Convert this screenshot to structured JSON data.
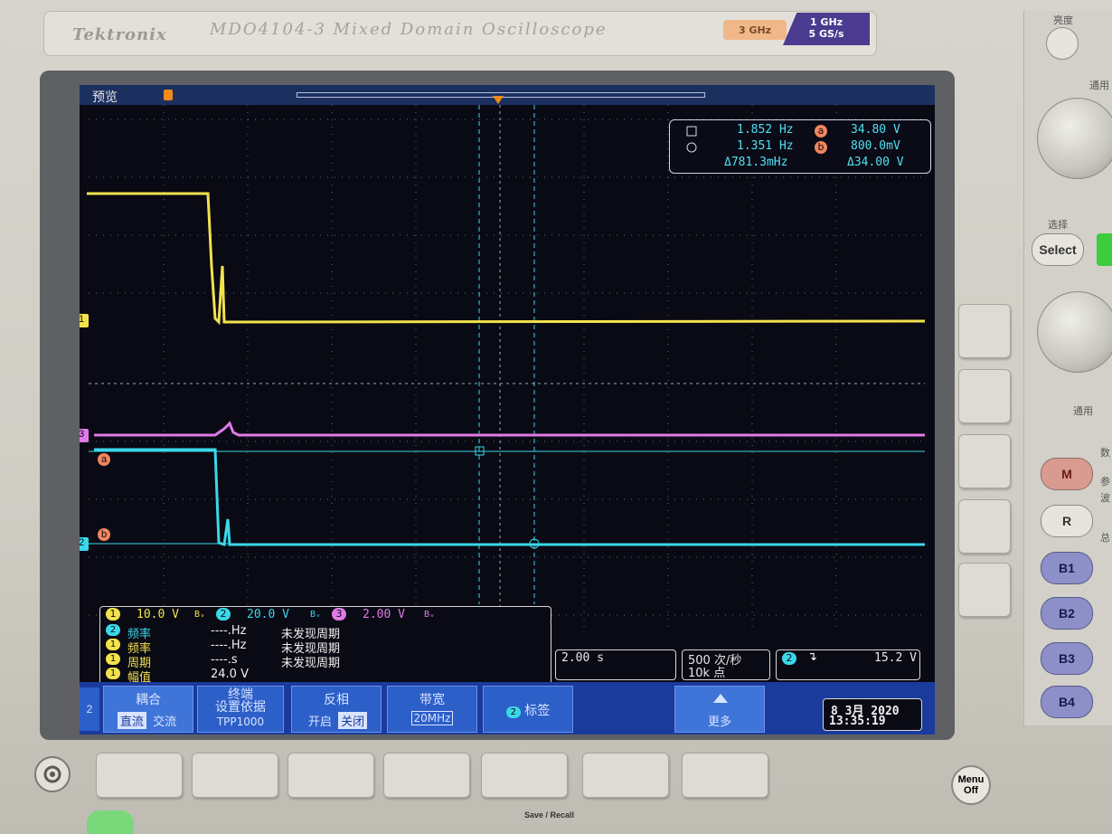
{
  "device": {
    "brand": "Tektronix",
    "model": "MDO4104-3  Mixed Domain Oscilloscope",
    "badge_rf": "3 GHz",
    "badge_bw_line1": "1 GHz",
    "badge_bw_line2": "5 GS/s"
  },
  "screen": {
    "mode": "预览",
    "trigger_marker": "T",
    "channel_markers": {
      "ch1": "1",
      "ch3": "3",
      "ch2": "2",
      "ref_a": "a",
      "ref_b": "b"
    }
  },
  "cursor_readout": {
    "square_freq": "1.852 Hz",
    "circle_freq": "1.351 Hz",
    "delta_freq": "Δ781.3mHz",
    "a_label": "a",
    "a_value": "34.80 V",
    "b_label": "b",
    "b_value": "800.0mV",
    "delta_v": "Δ34.00 V"
  },
  "channel_scales": [
    {
      "ch": "1",
      "value": "10.0 V",
      "color": "#f2e24c"
    },
    {
      "ch": "2",
      "value": "20.0 V",
      "color": "#3ad8e8"
    },
    {
      "ch": "3",
      "value": "2.00 V",
      "color": "#e07ae8"
    }
  ],
  "bw_icon": "Bᵥ",
  "measurements": [
    {
      "ch": "2",
      "name": "频率",
      "value": "----.Hz",
      "status": "未发现周期",
      "color": "#3ad8e8"
    },
    {
      "ch": "1",
      "name": "频率",
      "value": "----.Hz",
      "status": "未发现周期",
      "color": "#f2e24c"
    },
    {
      "ch": "1",
      "name": "周期",
      "value": "----.s",
      "status": "未发现周期",
      "color": "#f2e24c"
    },
    {
      "ch": "1",
      "name": "幅值",
      "value": "24.0 V",
      "status": "",
      "color": "#f2e24c"
    }
  ],
  "timebase": "2.00 s",
  "acq_line1": "500 次/秒",
  "acq_line2": "10k 点",
  "trigger": {
    "ch": "2",
    "slope_icon": "↴",
    "level": "15.2 V"
  },
  "menu": {
    "side_ch": "2",
    "coupling_title": "耦合",
    "coupling_opt1": "直流",
    "coupling_opt2": "交流",
    "term_title1": "终端",
    "term_title2": "设置依据",
    "term_value": "TPP1000",
    "invert_title": "反相",
    "invert_opt1": "开启",
    "invert_opt2": "关闭",
    "bw_title": "带宽",
    "bw_value": "20MHz",
    "label_ch": "2",
    "label_title": "标签",
    "more_label": "更多"
  },
  "datetime": {
    "date": "8 3月  2020",
    "time": "13:35:19"
  },
  "right_panel": {
    "top_label": "亮度",
    "select_label": "选择",
    "select_button": "Select",
    "general_top": "通用",
    "general_bottom": "通用",
    "m_button": "M",
    "r_button": "R",
    "b_buttons": [
      "B1",
      "B2",
      "B3",
      "B4"
    ],
    "side_text": [
      "数",
      "参",
      "波",
      "总"
    ],
    "menu_off_line1": "Menu",
    "menu_off_line2": "Off"
  },
  "save_recall": "Save / Recall"
}
